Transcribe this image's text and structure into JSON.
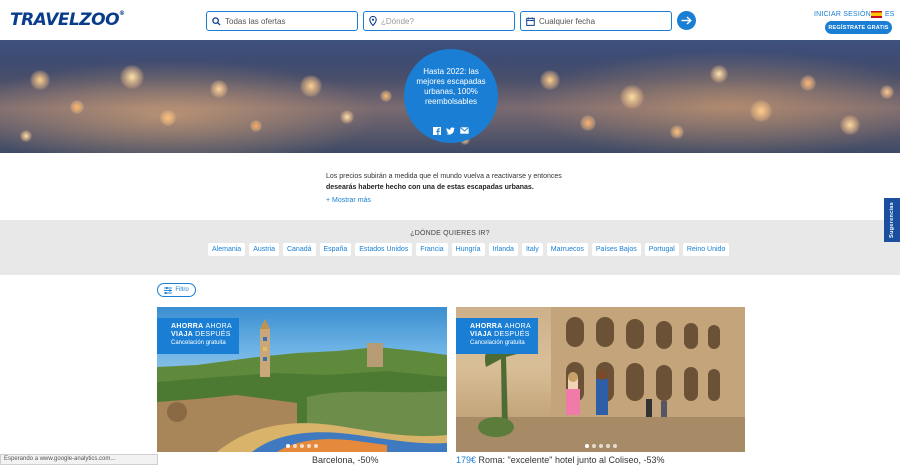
{
  "header": {
    "logo": "TRAVELZOO",
    "logo_mark": "®",
    "search_offers": "Todas las ofertas",
    "search_where_placeholder": "¿Dónde?",
    "search_date": "Cualquier fecha",
    "signin": "INICIAR SESIÓN",
    "language": "ES",
    "register": "REGÍSTRATE GRATIS"
  },
  "hero": {
    "headline": "Hasta 2022: las mejores escapadas urbanas, 100% reembolsables",
    "share_icons": [
      "facebook-icon",
      "twitter-icon",
      "mail-icon"
    ]
  },
  "intro": {
    "line1": "Los precios subirán a medida que el mundo vuelva a reactivarse y entonces",
    "line2_bold": "desearás haberte hecho con una de estas escapadas urbanas.",
    "more": "+ Mostrar más"
  },
  "destinations": {
    "title": "¿DÓNDE QUIERES IR?",
    "items": [
      "Alemania",
      "Austria",
      "Canadá",
      "España",
      "Estados Unidos",
      "Francia",
      "Hungría",
      "Irlanda",
      "Italy",
      "Marruecos",
      "Países Bajos",
      "Portugal",
      "Reino Unido"
    ]
  },
  "sidebar_tab": "Sugerencias",
  "filter_label": "Filtro",
  "cards": [
    {
      "badge_line1_a": "AHORRA",
      "badge_line1_b": "AHORA",
      "badge_line2_a": "VIAJA",
      "badge_line2_b": "DESPUÉS",
      "badge_line3": "Cancelación gratuita",
      "caption": "Barcelona, -50%"
    },
    {
      "badge_line1_a": "AHORRA",
      "badge_line1_b": "AHORA",
      "badge_line2_a": "VIAJA",
      "badge_line2_b": "DESPUÉS",
      "badge_line3": "Cancelación gratuita",
      "price": "179€",
      "caption": "Roma: \"excelente\" hotel junto al Coliseo, -53%"
    }
  ],
  "status_bar": "Esperando a www.google-analytics.com...",
  "colors": {
    "brand_blue": "#1a7fd4",
    "logo_navy": "#0a3c8c",
    "sidebar_tab": "#1a4fa0"
  }
}
